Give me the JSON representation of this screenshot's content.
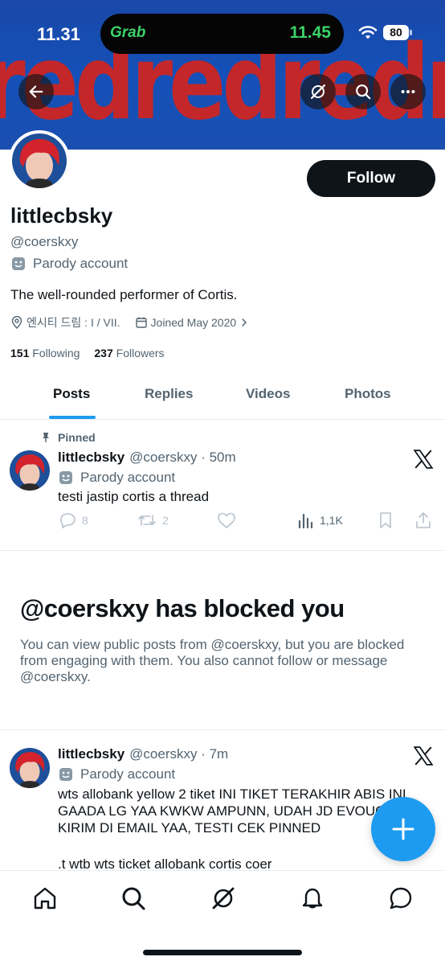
{
  "status_bar": {
    "time": "11.31",
    "island_app": "Grab",
    "island_time": "11.45",
    "battery": "80"
  },
  "banner": {
    "text": "redredredred"
  },
  "profile": {
    "display_name": "littlecbsky",
    "handle": "@coerskxy",
    "parody_label": "Parody account",
    "bio": "The well-rounded performer of Cortis.",
    "location": "엔시티 드림 : I / VII.",
    "joined": "Joined May 2020",
    "following_count": "151",
    "following_label": "Following",
    "followers_count": "237",
    "followers_label": "Followers",
    "follow_button": "Follow"
  },
  "tabs": [
    {
      "label": "Posts",
      "active": true
    },
    {
      "label": "Replies",
      "active": false
    },
    {
      "label": "Videos",
      "active": false
    },
    {
      "label": "Photos",
      "active": false
    }
  ],
  "pinned_post": {
    "pinned_label": "Pinned",
    "name": "littlecbsky",
    "handle": "@coerskxy · 50m",
    "parody_label": "Parody account",
    "text": "testi jastip cortis a thread",
    "replies": "8",
    "reposts": "2",
    "views": "1,1K"
  },
  "blocked": {
    "title": "@coerskxy has blocked you",
    "message": "You can view public posts from @coerskxy, but you are blocked from engaging with them. You also cannot follow or message @coerskxy."
  },
  "second_post": {
    "name": "littlecbsky",
    "handle": "@coerskxy · 7m",
    "parody_label": "Parody account",
    "text": "wts allobank yellow 2 tiket INI TIKET TERAKHIR ABIS INI GAADA LG YAA KWKW AMPUNN, UDAH JD EVOUCH KIRIM DI EMAIL YAA, TESTI CEK PINNED",
    "text2": ".t wtb wts ticket allobank cortis coer"
  },
  "colors": {
    "accent": "#1d9bf0",
    "text_primary": "#0f1419",
    "text_secondary": "#536471",
    "banner_blue": "#1a4fb0",
    "banner_red": "#c4272a"
  }
}
